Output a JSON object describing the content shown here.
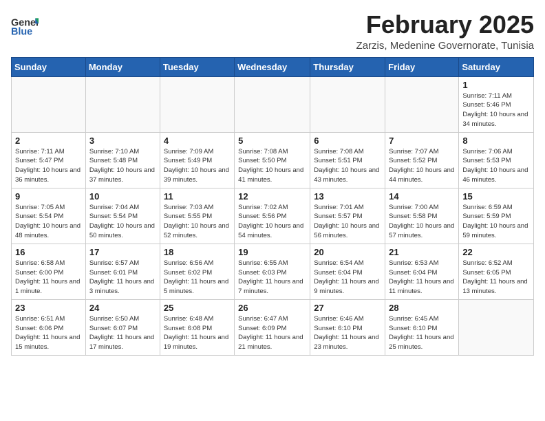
{
  "header": {
    "logo_general": "General",
    "logo_blue": "Blue",
    "month": "February 2025",
    "location": "Zarzis, Medenine Governorate, Tunisia"
  },
  "weekdays": [
    "Sunday",
    "Monday",
    "Tuesday",
    "Wednesday",
    "Thursday",
    "Friday",
    "Saturday"
  ],
  "weeks": [
    [
      {
        "day": "",
        "info": ""
      },
      {
        "day": "",
        "info": ""
      },
      {
        "day": "",
        "info": ""
      },
      {
        "day": "",
        "info": ""
      },
      {
        "day": "",
        "info": ""
      },
      {
        "day": "",
        "info": ""
      },
      {
        "day": "1",
        "info": "Sunrise: 7:11 AM\nSunset: 5:46 PM\nDaylight: 10 hours and 34 minutes."
      }
    ],
    [
      {
        "day": "2",
        "info": "Sunrise: 7:11 AM\nSunset: 5:47 PM\nDaylight: 10 hours and 36 minutes."
      },
      {
        "day": "3",
        "info": "Sunrise: 7:10 AM\nSunset: 5:48 PM\nDaylight: 10 hours and 37 minutes."
      },
      {
        "day": "4",
        "info": "Sunrise: 7:09 AM\nSunset: 5:49 PM\nDaylight: 10 hours and 39 minutes."
      },
      {
        "day": "5",
        "info": "Sunrise: 7:08 AM\nSunset: 5:50 PM\nDaylight: 10 hours and 41 minutes."
      },
      {
        "day": "6",
        "info": "Sunrise: 7:08 AM\nSunset: 5:51 PM\nDaylight: 10 hours and 43 minutes."
      },
      {
        "day": "7",
        "info": "Sunrise: 7:07 AM\nSunset: 5:52 PM\nDaylight: 10 hours and 44 minutes."
      },
      {
        "day": "8",
        "info": "Sunrise: 7:06 AM\nSunset: 5:53 PM\nDaylight: 10 hours and 46 minutes."
      }
    ],
    [
      {
        "day": "9",
        "info": "Sunrise: 7:05 AM\nSunset: 5:54 PM\nDaylight: 10 hours and 48 minutes."
      },
      {
        "day": "10",
        "info": "Sunrise: 7:04 AM\nSunset: 5:54 PM\nDaylight: 10 hours and 50 minutes."
      },
      {
        "day": "11",
        "info": "Sunrise: 7:03 AM\nSunset: 5:55 PM\nDaylight: 10 hours and 52 minutes."
      },
      {
        "day": "12",
        "info": "Sunrise: 7:02 AM\nSunset: 5:56 PM\nDaylight: 10 hours and 54 minutes."
      },
      {
        "day": "13",
        "info": "Sunrise: 7:01 AM\nSunset: 5:57 PM\nDaylight: 10 hours and 56 minutes."
      },
      {
        "day": "14",
        "info": "Sunrise: 7:00 AM\nSunset: 5:58 PM\nDaylight: 10 hours and 57 minutes."
      },
      {
        "day": "15",
        "info": "Sunrise: 6:59 AM\nSunset: 5:59 PM\nDaylight: 10 hours and 59 minutes."
      }
    ],
    [
      {
        "day": "16",
        "info": "Sunrise: 6:58 AM\nSunset: 6:00 PM\nDaylight: 11 hours and 1 minute."
      },
      {
        "day": "17",
        "info": "Sunrise: 6:57 AM\nSunset: 6:01 PM\nDaylight: 11 hours and 3 minutes."
      },
      {
        "day": "18",
        "info": "Sunrise: 6:56 AM\nSunset: 6:02 PM\nDaylight: 11 hours and 5 minutes."
      },
      {
        "day": "19",
        "info": "Sunrise: 6:55 AM\nSunset: 6:03 PM\nDaylight: 11 hours and 7 minutes."
      },
      {
        "day": "20",
        "info": "Sunrise: 6:54 AM\nSunset: 6:04 PM\nDaylight: 11 hours and 9 minutes."
      },
      {
        "day": "21",
        "info": "Sunrise: 6:53 AM\nSunset: 6:04 PM\nDaylight: 11 hours and 11 minutes."
      },
      {
        "day": "22",
        "info": "Sunrise: 6:52 AM\nSunset: 6:05 PM\nDaylight: 11 hours and 13 minutes."
      }
    ],
    [
      {
        "day": "23",
        "info": "Sunrise: 6:51 AM\nSunset: 6:06 PM\nDaylight: 11 hours and 15 minutes."
      },
      {
        "day": "24",
        "info": "Sunrise: 6:50 AM\nSunset: 6:07 PM\nDaylight: 11 hours and 17 minutes."
      },
      {
        "day": "25",
        "info": "Sunrise: 6:48 AM\nSunset: 6:08 PM\nDaylight: 11 hours and 19 minutes."
      },
      {
        "day": "26",
        "info": "Sunrise: 6:47 AM\nSunset: 6:09 PM\nDaylight: 11 hours and 21 minutes."
      },
      {
        "day": "27",
        "info": "Sunrise: 6:46 AM\nSunset: 6:10 PM\nDaylight: 11 hours and 23 minutes."
      },
      {
        "day": "28",
        "info": "Sunrise: 6:45 AM\nSunset: 6:10 PM\nDaylight: 11 hours and 25 minutes."
      },
      {
        "day": "",
        "info": ""
      }
    ]
  ]
}
